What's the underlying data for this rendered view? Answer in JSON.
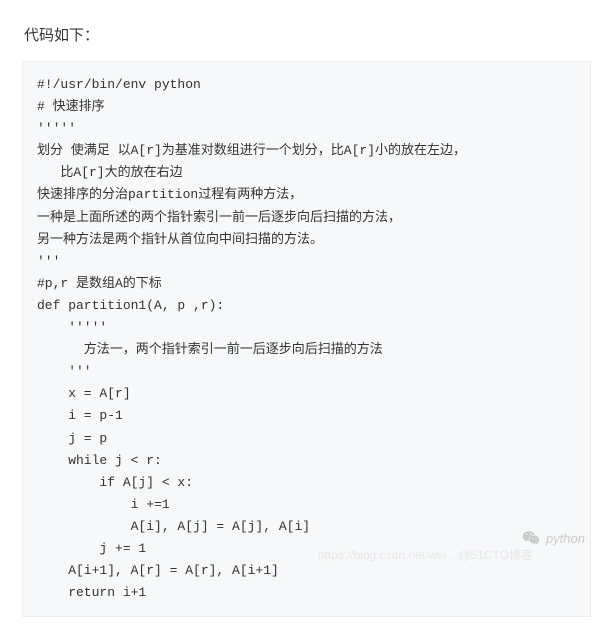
{
  "heading": "代码如下：",
  "code": "#!/usr/bin/env python\n# 快速排序\n'''''\n划分 使满足 以A[r]为基准对数组进行一个划分，比A[r]小的放在左边，\n   比A[r]大的放在右边\n快速排序的分治partition过程有两种方法，\n一种是上面所述的两个指针索引一前一后逐步向后扫描的方法，\n另一种方法是两个指针从首位向中间扫描的方法。\n'''\n#p,r 是数组A的下标\ndef partition1(A, p ,r):\n    '''''\n      方法一，两个指针索引一前一后逐步向后扫描的方法\n    '''\n    x = A[r]\n    i = p-1\n    j = p\n    while j < r:\n        if A[j] < x:\n            i +=1\n            A[i], A[j] = A[j], A[i]\n        j += 1\n    A[i+1], A[r] = A[r], A[i+1]\n    return i+1",
  "watermark_primary": "python",
  "watermark_secondary": "https://blog.csdn.net/wei…@51CTO博客"
}
